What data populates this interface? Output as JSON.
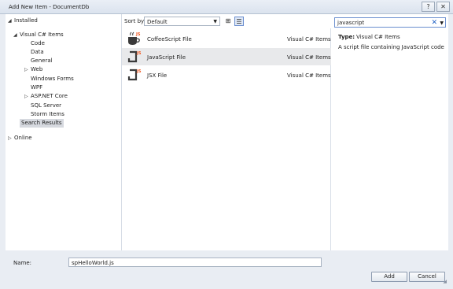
{
  "window": {
    "title": "Add New Item - DocumentDb",
    "help_label": "?",
    "close_label": "✕"
  },
  "tree": {
    "installed": "Installed",
    "visual_cs": "Visual C# Items",
    "code": "Code",
    "data": "Data",
    "general": "General",
    "web": "Web",
    "winforms": "Windows Forms",
    "wpf": "WPF",
    "aspnet": "ASP.NET Core",
    "sql": "SQL Server",
    "storm": "Storm Items",
    "search_results": "Search Results",
    "online": "Online"
  },
  "toolbar": {
    "sort_label": "Sort by:",
    "sort_value": "Default"
  },
  "templates": [
    {
      "name": "CoffeeScript File",
      "category": "Visual C# Items",
      "icon": "coffeescript-file-icon"
    },
    {
      "name": "JavaScript File",
      "category": "Visual C# Items",
      "icon": "javascript-file-icon"
    },
    {
      "name": "JSX File",
      "category": "Visual C# Items",
      "icon": "jsx-file-icon"
    }
  ],
  "details": {
    "search_value": "javascript",
    "type_label": "Type:",
    "type_value": "Visual C# Items",
    "description": "A script file containing JavaScript code"
  },
  "footer": {
    "name_label": "Name:",
    "name_value": "spHelloWorld.js",
    "add_label": "Add",
    "cancel_label": "Cancel"
  },
  "colors": {
    "selection": "#e8e9eb",
    "tree_selection": "#d6d9df",
    "accent": "#f05a23",
    "dialog_bg": "#e9edf3"
  }
}
